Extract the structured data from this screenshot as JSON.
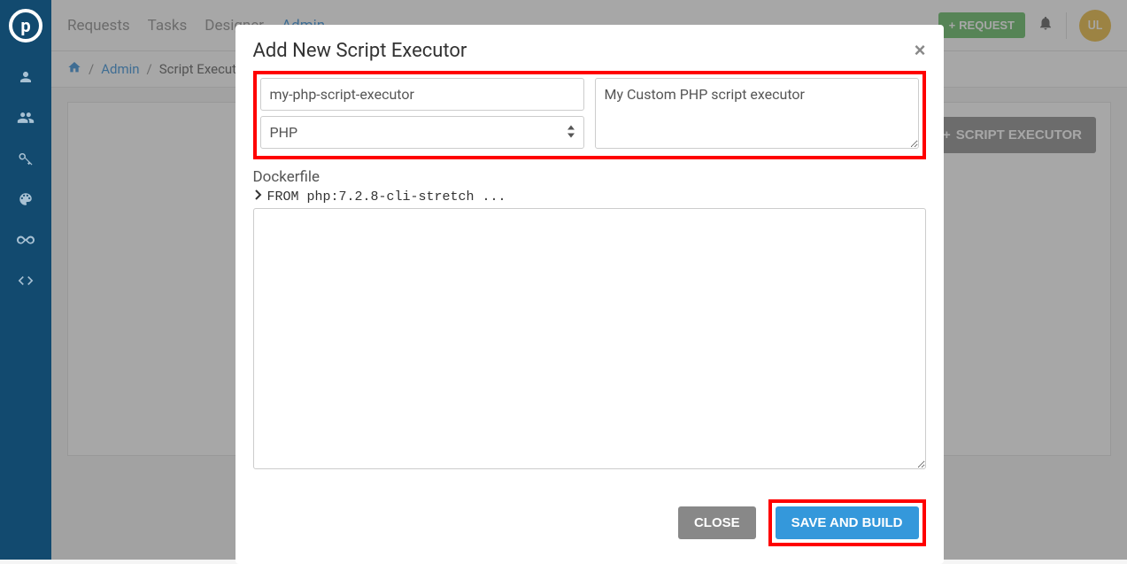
{
  "topnav": {
    "items": [
      "Requests",
      "Tasks",
      "Designer",
      "Admin"
    ],
    "request_btn": "REQUEST",
    "avatar_initials": "UL"
  },
  "breadcrumb": {
    "admin": "Admin",
    "current": "Script Executors"
  },
  "panel": {
    "script_executor_btn": "SCRIPT EXECUTOR"
  },
  "modal": {
    "title": "Add New Script Executor",
    "name_value": "my-php-script-executor",
    "language_value": "PHP",
    "description_value": "My Custom PHP script executor",
    "dockerfile_label": "Dockerfile",
    "dockerfile_preview": "FROM php:7.2.8-cli-stretch ...",
    "close_btn": "CLOSE",
    "save_btn": "SAVE AND BUILD"
  }
}
